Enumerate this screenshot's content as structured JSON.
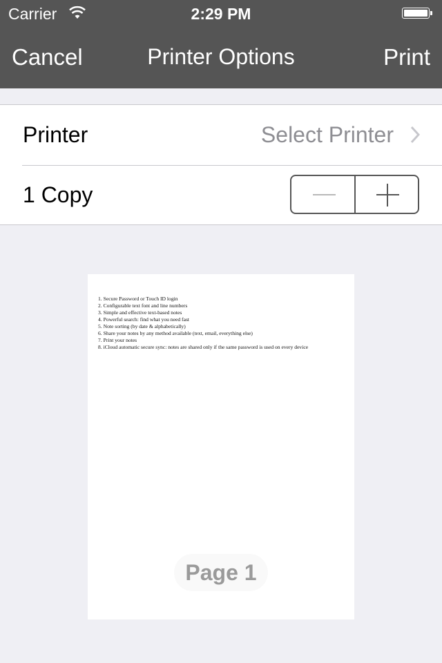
{
  "status_bar": {
    "carrier": "Carrier",
    "time": "2:29 PM",
    "wifi_icon": "wifi-icon",
    "battery_icon": "battery-icon"
  },
  "nav": {
    "cancel": "Cancel",
    "title": "Printer Options",
    "print": "Print"
  },
  "options": {
    "printer_label": "Printer",
    "printer_value": "Select Printer",
    "copies_label": "1 Copy",
    "copies": 1,
    "decrement_icon": "minus-icon",
    "increment_icon": "plus-icon"
  },
  "preview": {
    "lines": [
      "1. Secure Password or Touch ID login",
      "2. Configurable text font and line numbers",
      "3. Simple and effective text-based notes",
      "4. Powerful search: find what you need fast",
      "5. Note sorting (by date & alphabetically)",
      "6. Share your notes by any method available (text, email, everything else)",
      "7. Print your notes",
      "8. iCloud automatic secure sync: notes are shared only if the same password is used on every device"
    ],
    "page_label": "Page 1"
  }
}
